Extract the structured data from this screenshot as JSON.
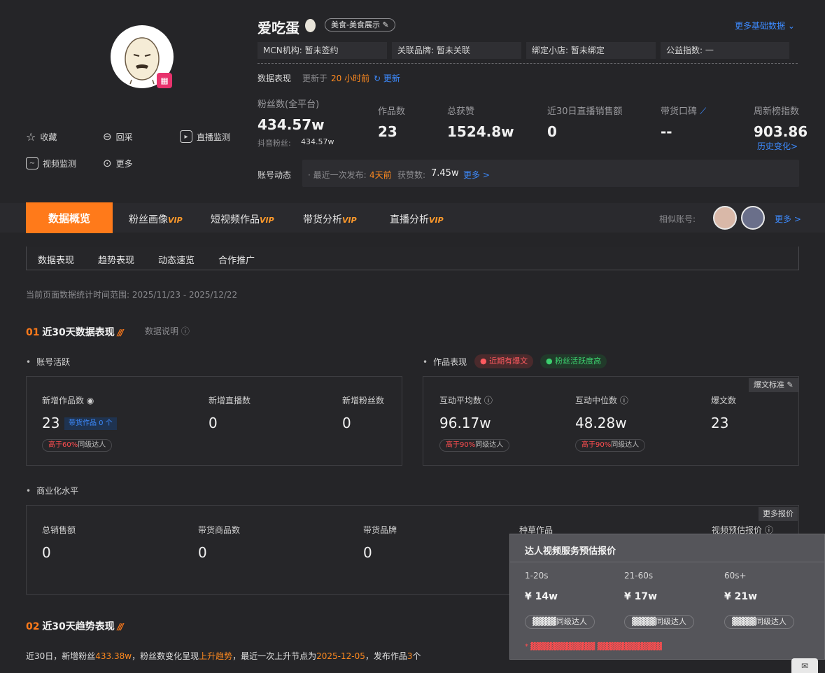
{
  "profile": {
    "name": "爱吃蛋",
    "category": "美食-美食展示",
    "more_basic_data": "更多基础数据",
    "mcn": "MCN机构: 暂未签约",
    "brand": "关联品牌: 暂未关联",
    "shop": "绑定小店: 暂未绑定",
    "charity": "公益指数: 一",
    "perf_label": "数据表现",
    "updated": "更新于",
    "updated_time": "20 小时前",
    "update_btn": "更新"
  },
  "stats": {
    "fans_label": "粉丝数(全平台)",
    "fans_value": "434.57w",
    "douyin_fans_label": "抖音粉丝:",
    "douyin_fans_value": "434.57w",
    "works_label": "作品数",
    "works_value": "23",
    "likes_label": "总获赞",
    "likes_value": "1524.8w",
    "live_sales_label": "近30日直播销售额",
    "live_sales_value": "0",
    "reputation_label": "带货口碑",
    "reputation_value": "--",
    "weekly_index_label": "周新榜指数",
    "weekly_index_value": "903.86",
    "history_change": "历史变化>"
  },
  "dynamics": {
    "label": "账号动态",
    "last_post_label": "· 最近一次发布:",
    "last_post_value": "4天前",
    "likes_label": "获赞数:",
    "likes_value": "7.45w",
    "more": "更多 >"
  },
  "actions": {
    "favorite": "收藏",
    "recollect": "回采",
    "live_monitor": "直播监测",
    "video_monitor": "视频监测",
    "more": "更多"
  },
  "tabs": {
    "overview": "数据概览",
    "fans": "粉丝画像",
    "short_video": "短视频作品",
    "commerce": "带货分析",
    "live": "直播分析",
    "vip": "VIP",
    "similar": "相似账号:",
    "more": "更多 >"
  },
  "subtabs": [
    "数据表现",
    "趋势表现",
    "动态速览",
    "合作推广"
  ],
  "range": "当前页面数据统计时间范围: 2025/11/23 - 2025/12/22",
  "section1": {
    "num": "01",
    "title": "近30天数据表现",
    "explain": "数据说明",
    "activity_label": "账号活跃",
    "works_perf_label": "作品表现",
    "badge_hot": "近期有爆文",
    "badge_active": "粉丝活跃度高",
    "new_works_label": "新增作品数",
    "new_works_value": "23",
    "commerce_works": "带货作品 0 个",
    "new_works_pill_hi": "高于60%",
    "peer": "同级达人",
    "new_live_label": "新增直播数",
    "new_live_value": "0",
    "new_fans_label": "新增粉丝数",
    "new_fans_value": "0",
    "interact_avg_label": "互动平均数",
    "interact_avg_value": "96.17w",
    "interact_avg_pill_hi": "高于90%",
    "interact_med_label": "互动中位数",
    "interact_med_value": "48.28w",
    "interact_med_pill_hi": "高于90%",
    "hot_count_label": "爆文数",
    "hot_count_value": "23",
    "hot_standard": "爆文标准"
  },
  "commerce": {
    "label": "商业化水平",
    "more_quote": "更多报价",
    "total_sales_label": "总销售额",
    "total_sales_value": "0",
    "goods_count_label": "带货商品数",
    "goods_count_value": "0",
    "brands_label": "带货品牌",
    "brands_value": "0",
    "seeding_label": "种草作品",
    "quote_label": "视频预估报价"
  },
  "popup": {
    "title": "达人视频服务预估报价",
    "cols": [
      {
        "label": "1-20s",
        "value": "¥ 14w",
        "pill": "同级达人"
      },
      {
        "label": "21-60s",
        "value": "¥ 17w",
        "pill": "同级达人"
      },
      {
        "label": "60s+",
        "value": "¥ 21w",
        "pill": "同级达人"
      }
    ]
  },
  "section2": {
    "num": "02",
    "title": "近30天趋势表现",
    "t1": "近30日，新增粉丝",
    "fans_add": "433.38w",
    "t2": "，粉丝数变化呈现",
    "trend": "上升趋势",
    "t3": "，最近一次上升节点为",
    "date": "2025-12-05",
    "t4": "，发布作品",
    "works": "3",
    "t5": "个"
  }
}
